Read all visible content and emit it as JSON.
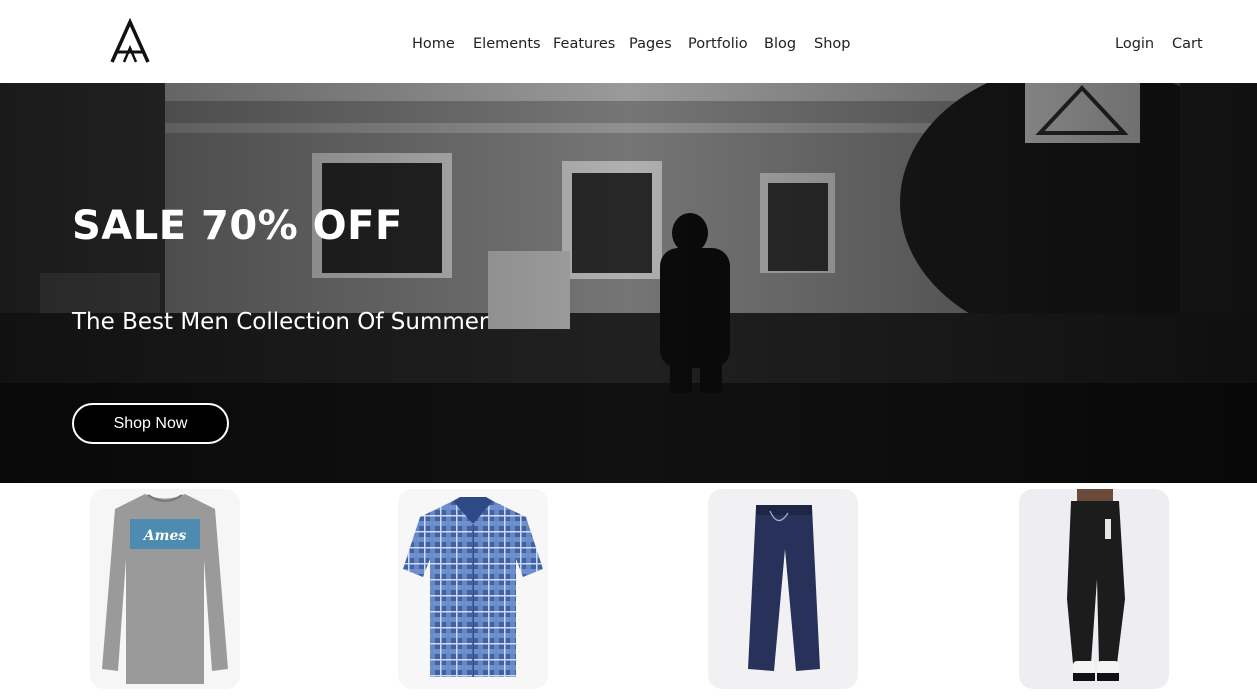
{
  "header": {
    "logo_icon": "letter-a-logo-icon",
    "nav": [
      {
        "label": "Home"
      },
      {
        "label": "Elements"
      },
      {
        "label": "Features"
      },
      {
        "label": "Pages"
      },
      {
        "label": "Portfolio"
      },
      {
        "label": "Blog"
      },
      {
        "label": "Shop"
      }
    ],
    "login": "Login",
    "cart": "Cart"
  },
  "hero": {
    "title": "SALE 70% OFF",
    "subtitle": "The Best Men Collection Of Summer",
    "button": "Shop Now",
    "image": "black-and-white-street-photo"
  },
  "products": [
    {
      "image": "grey-long-sleeve-shirt",
      "print": "Ames"
    },
    {
      "image": "blue-plaid-short-sleeve-shirt"
    },
    {
      "image": "navy-trousers"
    },
    {
      "image": "black-track-pants"
    }
  ],
  "colors": {
    "hero_overlay": "#000000",
    "button_bg": "#000000",
    "button_border": "#ffffff",
    "text_light": "#ffffff"
  }
}
